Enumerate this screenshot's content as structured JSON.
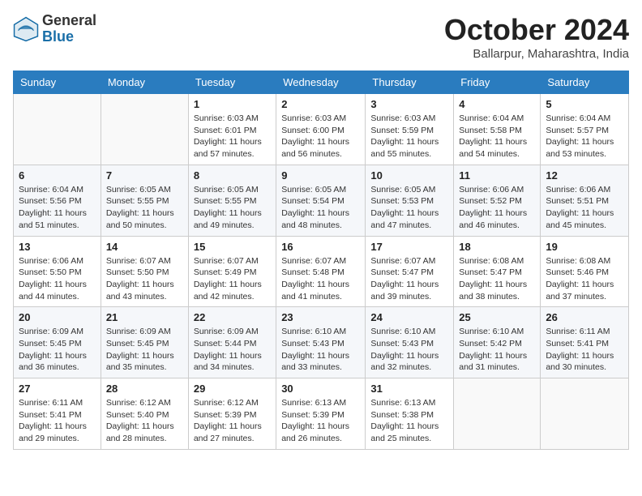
{
  "header": {
    "logo_general": "General",
    "logo_blue": "Blue",
    "month_title": "October 2024",
    "subtitle": "Ballarpur, Maharashtra, India"
  },
  "days_of_week": [
    "Sunday",
    "Monday",
    "Tuesday",
    "Wednesday",
    "Thursday",
    "Friday",
    "Saturday"
  ],
  "weeks": [
    [
      {
        "day": "",
        "info": ""
      },
      {
        "day": "",
        "info": ""
      },
      {
        "day": "1",
        "info": "Sunrise: 6:03 AM\nSunset: 6:01 PM\nDaylight: 11 hours and 57 minutes."
      },
      {
        "day": "2",
        "info": "Sunrise: 6:03 AM\nSunset: 6:00 PM\nDaylight: 11 hours and 56 minutes."
      },
      {
        "day": "3",
        "info": "Sunrise: 6:03 AM\nSunset: 5:59 PM\nDaylight: 11 hours and 55 minutes."
      },
      {
        "day": "4",
        "info": "Sunrise: 6:04 AM\nSunset: 5:58 PM\nDaylight: 11 hours and 54 minutes."
      },
      {
        "day": "5",
        "info": "Sunrise: 6:04 AM\nSunset: 5:57 PM\nDaylight: 11 hours and 53 minutes."
      }
    ],
    [
      {
        "day": "6",
        "info": "Sunrise: 6:04 AM\nSunset: 5:56 PM\nDaylight: 11 hours and 51 minutes."
      },
      {
        "day": "7",
        "info": "Sunrise: 6:05 AM\nSunset: 5:55 PM\nDaylight: 11 hours and 50 minutes."
      },
      {
        "day": "8",
        "info": "Sunrise: 6:05 AM\nSunset: 5:55 PM\nDaylight: 11 hours and 49 minutes."
      },
      {
        "day": "9",
        "info": "Sunrise: 6:05 AM\nSunset: 5:54 PM\nDaylight: 11 hours and 48 minutes."
      },
      {
        "day": "10",
        "info": "Sunrise: 6:05 AM\nSunset: 5:53 PM\nDaylight: 11 hours and 47 minutes."
      },
      {
        "day": "11",
        "info": "Sunrise: 6:06 AM\nSunset: 5:52 PM\nDaylight: 11 hours and 46 minutes."
      },
      {
        "day": "12",
        "info": "Sunrise: 6:06 AM\nSunset: 5:51 PM\nDaylight: 11 hours and 45 minutes."
      }
    ],
    [
      {
        "day": "13",
        "info": "Sunrise: 6:06 AM\nSunset: 5:50 PM\nDaylight: 11 hours and 44 minutes."
      },
      {
        "day": "14",
        "info": "Sunrise: 6:07 AM\nSunset: 5:50 PM\nDaylight: 11 hours and 43 minutes."
      },
      {
        "day": "15",
        "info": "Sunrise: 6:07 AM\nSunset: 5:49 PM\nDaylight: 11 hours and 42 minutes."
      },
      {
        "day": "16",
        "info": "Sunrise: 6:07 AM\nSunset: 5:48 PM\nDaylight: 11 hours and 41 minutes."
      },
      {
        "day": "17",
        "info": "Sunrise: 6:07 AM\nSunset: 5:47 PM\nDaylight: 11 hours and 39 minutes."
      },
      {
        "day": "18",
        "info": "Sunrise: 6:08 AM\nSunset: 5:47 PM\nDaylight: 11 hours and 38 minutes."
      },
      {
        "day": "19",
        "info": "Sunrise: 6:08 AM\nSunset: 5:46 PM\nDaylight: 11 hours and 37 minutes."
      }
    ],
    [
      {
        "day": "20",
        "info": "Sunrise: 6:09 AM\nSunset: 5:45 PM\nDaylight: 11 hours and 36 minutes."
      },
      {
        "day": "21",
        "info": "Sunrise: 6:09 AM\nSunset: 5:45 PM\nDaylight: 11 hours and 35 minutes."
      },
      {
        "day": "22",
        "info": "Sunrise: 6:09 AM\nSunset: 5:44 PM\nDaylight: 11 hours and 34 minutes."
      },
      {
        "day": "23",
        "info": "Sunrise: 6:10 AM\nSunset: 5:43 PM\nDaylight: 11 hours and 33 minutes."
      },
      {
        "day": "24",
        "info": "Sunrise: 6:10 AM\nSunset: 5:43 PM\nDaylight: 11 hours and 32 minutes."
      },
      {
        "day": "25",
        "info": "Sunrise: 6:10 AM\nSunset: 5:42 PM\nDaylight: 11 hours and 31 minutes."
      },
      {
        "day": "26",
        "info": "Sunrise: 6:11 AM\nSunset: 5:41 PM\nDaylight: 11 hours and 30 minutes."
      }
    ],
    [
      {
        "day": "27",
        "info": "Sunrise: 6:11 AM\nSunset: 5:41 PM\nDaylight: 11 hours and 29 minutes."
      },
      {
        "day": "28",
        "info": "Sunrise: 6:12 AM\nSunset: 5:40 PM\nDaylight: 11 hours and 28 minutes."
      },
      {
        "day": "29",
        "info": "Sunrise: 6:12 AM\nSunset: 5:39 PM\nDaylight: 11 hours and 27 minutes."
      },
      {
        "day": "30",
        "info": "Sunrise: 6:13 AM\nSunset: 5:39 PM\nDaylight: 11 hours and 26 minutes."
      },
      {
        "day": "31",
        "info": "Sunrise: 6:13 AM\nSunset: 5:38 PM\nDaylight: 11 hours and 25 minutes."
      },
      {
        "day": "",
        "info": ""
      },
      {
        "day": "",
        "info": ""
      }
    ]
  ]
}
